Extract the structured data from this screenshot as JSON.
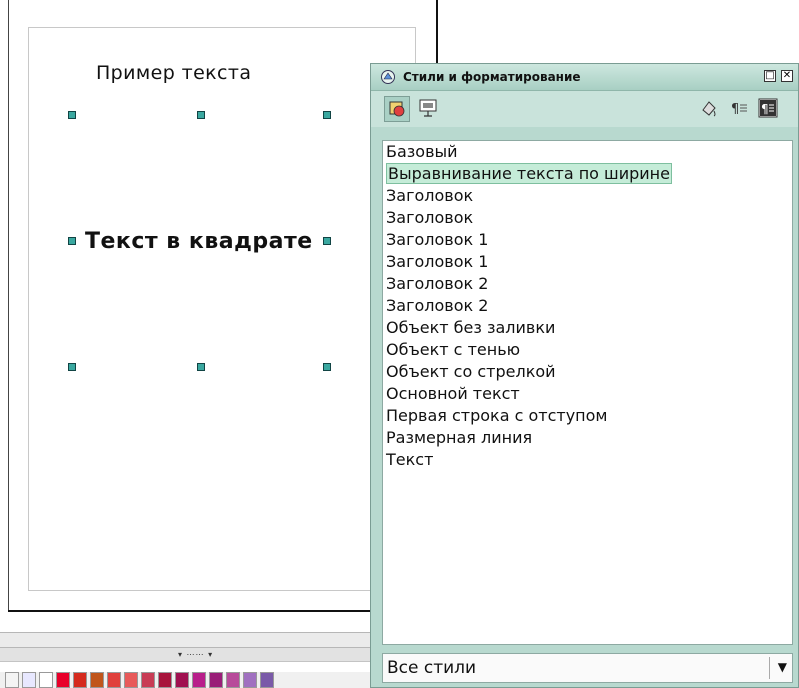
{
  "canvas": {
    "text_top": "Пример текста",
    "text_box": "Текст в квадрате"
  },
  "panel": {
    "title": "Стили и форматирование",
    "titlebar_buttons": {
      "restore": "□",
      "close": "✕"
    },
    "toolbar_icons": [
      "graphics-styles-icon",
      "presentation-styles-icon",
      "fill-format-mode-icon",
      "new-style-from-selection-icon",
      "update-style-icon"
    ],
    "styles": [
      "Базовый",
      "Выравнивание текста по ширине",
      "Заголовок",
      "Заголовок",
      "Заголовок 1",
      "Заголовок 1",
      "Заголовок 2",
      "Заголовок 2",
      "Объект без заливки",
      "Объект с тенью",
      "Объект со стрелкой",
      "Основной текст",
      "Первая строка с отступом",
      "Размерная линия",
      "Текст"
    ],
    "selected_style": "Выравнивание текста по ширине",
    "filter_value": "Все стили"
  },
  "palette_colors": [
    "#f4f4f4",
    "#e8e8ff",
    "#ffffff",
    "#e8002a",
    "#d52a1e",
    "#c0551b",
    "#e0403c",
    "#e85a5a",
    "#c83c55",
    "#a8143c",
    "#a01050",
    "#b81e8a",
    "#9a1e78",
    "#b84a9a",
    "#a070c0",
    "#7a5aa8"
  ],
  "colors": {
    "panel_bg": "#b8d9cf",
    "selected_bg": "#c5ecd8",
    "handle": "#3aa8a0"
  }
}
